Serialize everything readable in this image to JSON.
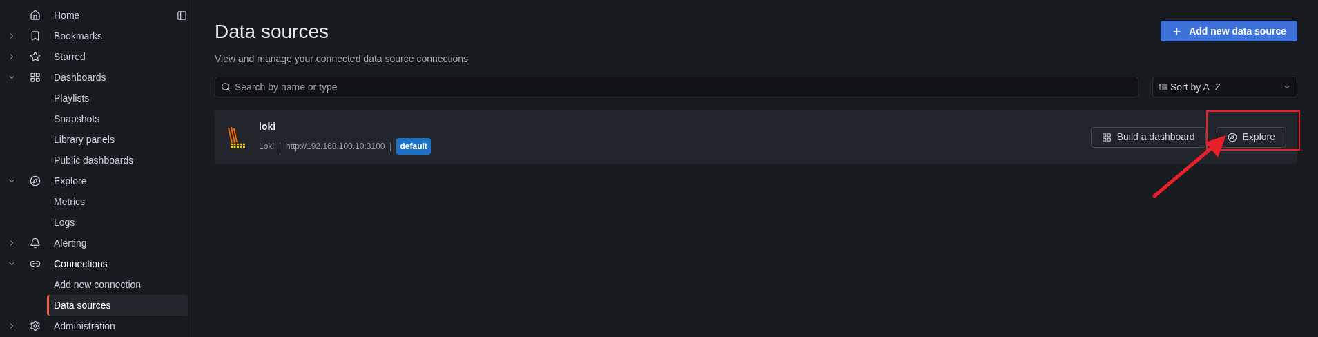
{
  "sidebar": {
    "items": [
      {
        "label": "Home"
      },
      {
        "label": "Bookmarks",
        "expanded": false
      },
      {
        "label": "Starred",
        "expanded": false
      },
      {
        "label": "Dashboards",
        "expanded": true,
        "children": [
          {
            "label": "Playlists",
            "selected": false
          },
          {
            "label": "Snapshots",
            "selected": false
          },
          {
            "label": "Library panels",
            "selected": false
          },
          {
            "label": "Public dashboards",
            "selected": false
          }
        ]
      },
      {
        "label": "Explore",
        "expanded": true,
        "children": [
          {
            "label": "Metrics",
            "selected": false
          },
          {
            "label": "Logs",
            "selected": false
          }
        ]
      },
      {
        "label": "Alerting",
        "expanded": false
      },
      {
        "label": "Connections",
        "expanded": true,
        "children": [
          {
            "label": "Add new connection",
            "selected": false
          },
          {
            "label": "Data sources",
            "selected": true
          }
        ]
      },
      {
        "label": "Administration",
        "expanded": false
      }
    ]
  },
  "page": {
    "title": "Data sources",
    "subtitle": "View and manage your connected data source connections",
    "add_button": "Add new data source"
  },
  "search": {
    "placeholder": "Search by name or type"
  },
  "sort": {
    "value": "Sort by A–Z"
  },
  "data_sources": [
    {
      "name": "loki",
      "type": "Loki",
      "url": "http://192.168.100.10:3100",
      "badge": "default",
      "actions": [
        "Build a dashboard",
        "Explore"
      ]
    }
  ]
}
